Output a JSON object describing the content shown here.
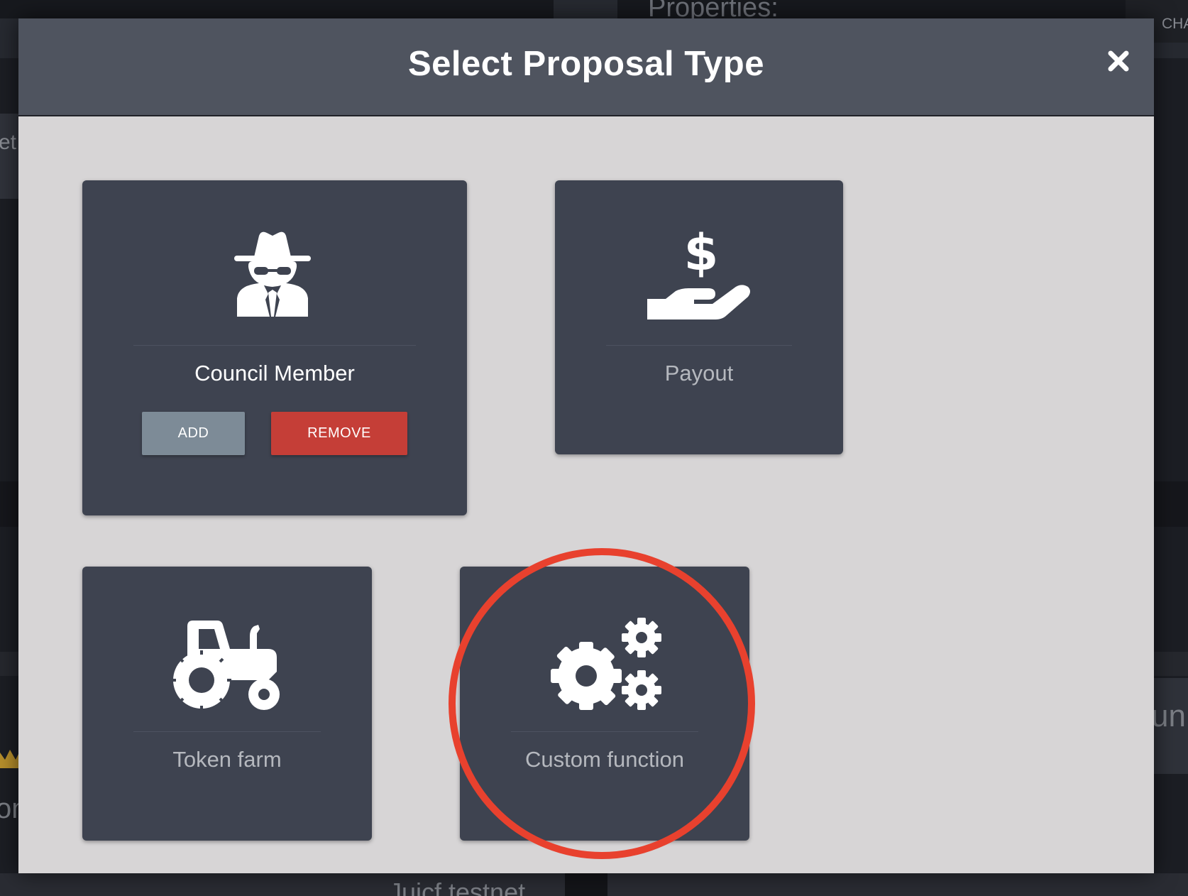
{
  "background": {
    "properties_text": "Properties:",
    "top_right_text": "CHA",
    "left_text": "et",
    "right_text": "un",
    "left_bottom_text": "on",
    "bottom_text": "Juicf testnet"
  },
  "modal": {
    "title": "Select Proposal Type",
    "close_icon": "close-icon"
  },
  "cards": {
    "council": {
      "label": "Council Member",
      "icon": "user-secret-icon",
      "add_label": "ADD",
      "remove_label": "REMOVE"
    },
    "payout": {
      "label": "Payout",
      "icon": "hand-holding-usd-icon"
    },
    "token_farm": {
      "label": "Token farm",
      "icon": "tractor-icon"
    },
    "custom_function": {
      "label": "Custom function",
      "icon": "cogs-icon",
      "highlighted": true
    }
  },
  "colors": {
    "modal_bg": "#d7d5d6",
    "header_bg": "#4f545f",
    "card_bg": "#3e4350",
    "add_button": "#7d8b97",
    "remove_button": "#c53e37",
    "highlight_ring": "#e8412e"
  }
}
